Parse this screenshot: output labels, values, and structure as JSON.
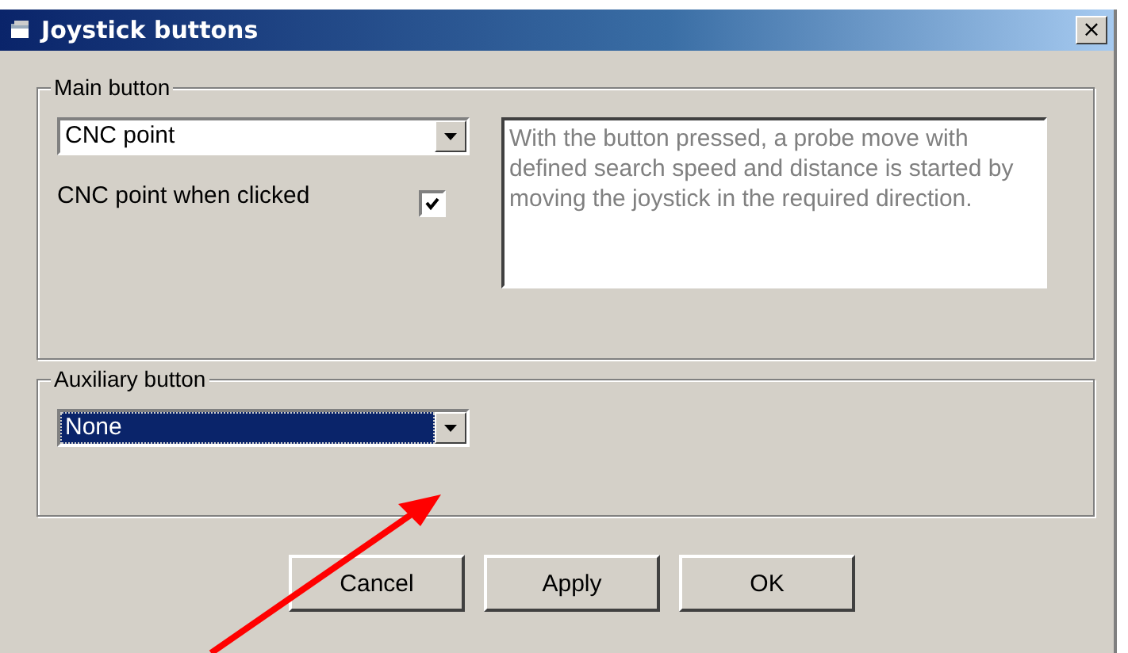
{
  "window": {
    "title": "Joystick buttons",
    "close": "×"
  },
  "main_group": {
    "label": "Main button",
    "dropdown": {
      "value": "CNC point",
      "focused": false
    },
    "checkbox": {
      "label": "CNC point when clicked",
      "checked": true
    },
    "description": "With the button pressed, a probe move with defined search speed and distance is started by moving the joystick in the required direction."
  },
  "auxiliary_group": {
    "label": "Auxiliary button",
    "dropdown": {
      "value": "None",
      "focused": true
    }
  },
  "buttons": [
    "Cancel",
    "Apply",
    "OK"
  ]
}
